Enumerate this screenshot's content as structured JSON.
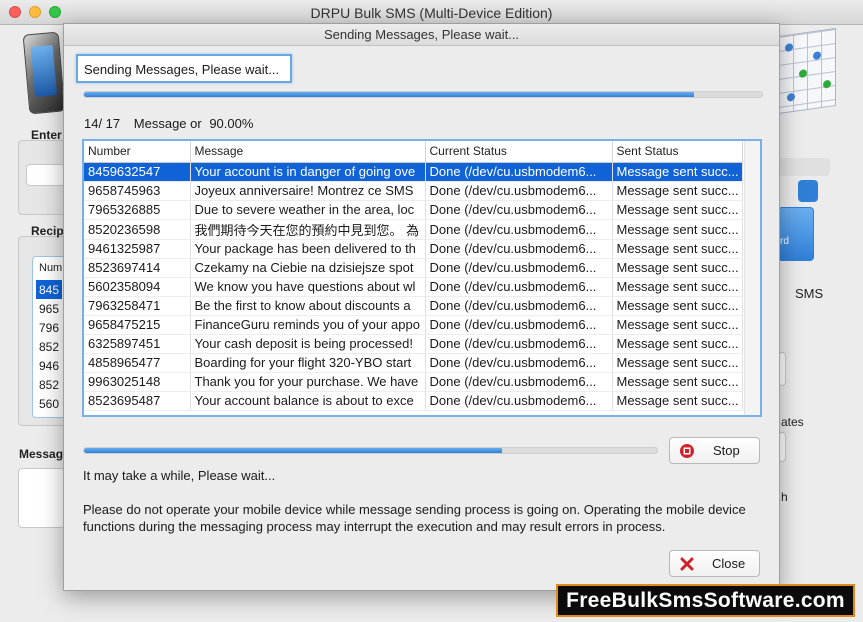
{
  "window": {
    "title": "DRPU Bulk SMS (Multi-Device Edition)"
  },
  "background": {
    "enter_label": "Enter",
    "recipients_label": "Recip",
    "list_header": "Num",
    "list_items": [
      "845",
      "965",
      "796",
      "852",
      "946",
      "852",
      "560"
    ],
    "message_label": "Messag",
    "right_button_fragment": "rd",
    "sms_label": "SMS",
    "templates_fragment": "ates",
    "h_fragment": "h"
  },
  "dialog": {
    "title": "Sending Messages, Please wait...",
    "status_text": "Sending Messages, Please wait...",
    "progress_top": 0.9,
    "count": {
      "sent": "14/ 17",
      "label": "Message or",
      "percent": "90.00%"
    },
    "columns": [
      "Number",
      "Message",
      "Current Status",
      "Sent Status"
    ],
    "rows": [
      [
        "8459632547",
        "Your account is in danger of going ove",
        "Done (/dev/cu.usbmodem6...",
        "Message sent succ..."
      ],
      [
        "9658745963",
        "Joyeux anniversaire! Montrez ce SMS",
        "Done (/dev/cu.usbmodem6...",
        "Message sent succ..."
      ],
      [
        "7965326885",
        "Due to severe weather in the area, loc",
        "Done (/dev/cu.usbmodem6...",
        "Message sent succ..."
      ],
      [
        "8520236598",
        "我們期待今天在您的預約中見到您。 為",
        "Done (/dev/cu.usbmodem6...",
        "Message sent succ..."
      ],
      [
        "9461325987",
        "Your package has been delivered to th",
        "Done (/dev/cu.usbmodem6...",
        "Message sent succ..."
      ],
      [
        "8523697414",
        "Czekamy na Ciebie na dzisiejsze spot",
        "Done (/dev/cu.usbmodem6...",
        "Message sent succ..."
      ],
      [
        "5602358094",
        "We know you have questions about wl",
        "Done (/dev/cu.usbmodem6...",
        "Message sent succ..."
      ],
      [
        "7963258471",
        "Be the first to know about discounts a",
        "Done (/dev/cu.usbmodem6...",
        "Message sent succ..."
      ],
      [
        "9658475215",
        "FinanceGuru reminds you of your appo",
        "Done (/dev/cu.usbmodem6...",
        "Message sent succ..."
      ],
      [
        "6325897451",
        "Your cash deposit is being processed!",
        "Done (/dev/cu.usbmodem6...",
        "Message sent succ..."
      ],
      [
        "4858965477",
        "Boarding for your flight 320-YBO start",
        "Done (/dev/cu.usbmodem6...",
        "Message sent succ..."
      ],
      [
        "9963025148",
        "Thank you for your purchase. We have",
        "Done (/dev/cu.usbmodem6...",
        "Message sent succ..."
      ],
      [
        "8523695487",
        "Your account balance is about to exce",
        "Done (/dev/cu.usbmodem6...",
        "Message sent succ..."
      ]
    ],
    "progress_bottom": 0.73,
    "stop_label": "Stop",
    "wait_text": "It may take a while, Please wait...",
    "warning_text": "Please do not operate your mobile device while message sending process is going on. Operating the mobile device functions during the messaging process may interrupt the execution and may result errors in process.",
    "close_label": "Close"
  },
  "watermark": "FreeBulkSmsSoftware.com",
  "colors": {
    "accent": "#0f63d6",
    "stop": "#d0202a",
    "close": "#d0202a",
    "watermark_border": "#e08a1e"
  }
}
